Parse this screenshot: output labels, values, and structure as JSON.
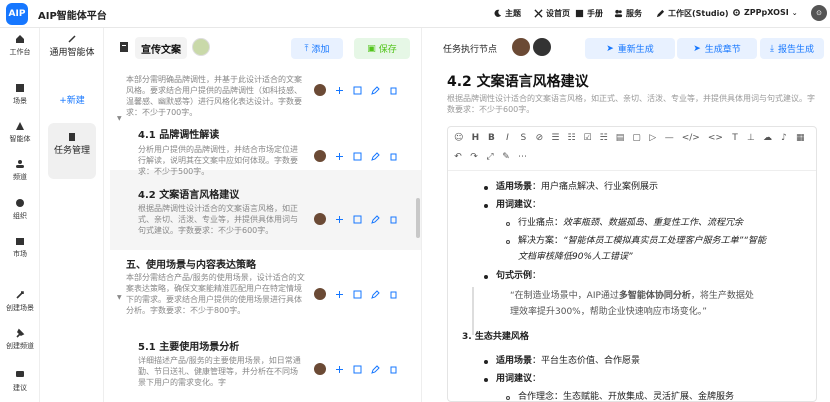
{
  "app": {
    "logo": "AIP",
    "title": "AIP智能体平台"
  },
  "topnav": [
    {
      "label": "主题",
      "icon": "moon-icon"
    },
    {
      "label": "设首页",
      "icon": "tools-icon"
    },
    {
      "label": "手册",
      "icon": "book-icon"
    },
    {
      "label": "服务",
      "icon": "users-icon"
    },
    {
      "label": "工作区(Studio)",
      "icon": "pen-icon"
    },
    {
      "label": "ZPPpXOSI",
      "icon": "gear-icon"
    }
  ],
  "leftnav": [
    {
      "label": "工作台"
    },
    {
      "label": "场景"
    },
    {
      "label": "智能体"
    },
    {
      "label": "频道"
    },
    {
      "label": "组织"
    },
    {
      "label": "市场"
    },
    {
      "label": "创建场景"
    },
    {
      "label": "创建频道"
    },
    {
      "label": "建议"
    }
  ],
  "panel2": {
    "title": "通用智能体",
    "new_label": "+新建",
    "task_label": "任务管理"
  },
  "doc": {
    "title": "宣传文案",
    "add_label": "添加",
    "save_label": "保存"
  },
  "outline": {
    "intro": "本部分需明确品牌调性，并基于此设计适合的文案风格。要求结合用户提供的品牌调性（如科技感、温馨感、幽默感等）进行风格化表达设计。字数要求：不少于700字。",
    "h41": "4.1 品牌调性解读",
    "t41": "分析用户提供的品牌调性，并结合市场定位进行解读，说明其在文案中应如何体现。字数要求：不少于500字。",
    "h42": "4.2 文案语言风格建议",
    "t42": "根据品牌调性设计适合的文案语言风格，如正式、亲切、活泼、专业等，并提供具体用词与句式建议。字数要求：不少于600字。",
    "h5": "五、使用场景与内容表达策略",
    "t5": "本部分需结合产品/服务的使用场景，设计适合的文案表达策略，确保文案能精准匹配用户在特定情境下的需求。要求结合用户提供的使用场景进行具体分析。字数要求：不少于800字。",
    "h51": "5.1 主要使用场景分析",
    "t51": "详细描述产品/服务的主要使用场景，如日常通勤、节日送礼、健康管理等，并分析在不同场景下用户的需求变化。字"
  },
  "right": {
    "label": "任务执行节点",
    "regen": "重新生成",
    "gen_chapter": "生成章节",
    "gen_report": "报告生成",
    "title": "4.2 文案语言风格建议",
    "desc": "根据品牌调性设计适合的文案语言风格，如正式、亲切、活泼、专业等，并提供具体用词与句式建议。字数要求：不少于600字。",
    "toolbar_row1": [
      "☺",
      "H",
      "B",
      "I",
      "S",
      "⊘",
      "☰",
      "☷",
      "☑",
      "☵",
      "▤",
      "▢",
      "▷",
      "—",
      "</>",
      "<>",
      "T",
      "⊥",
      "☁",
      "♪",
      "▦"
    ],
    "toolbar_row2": [
      "↶",
      "↷",
      "⤢",
      "✎",
      "⋯"
    ],
    "c1_label": "适用场景",
    "c1_text": "：用户痛点解决、行业案例展示",
    "c2_label": "用词建议",
    "c2_text": "：",
    "c3_pre": "行业痛点：",
    "c3_text": "效率瓶颈、数据孤岛、重复性工作、流程冗余",
    "c4_pre": "解决方案：",
    "c4_text": "“智能体员工模拟真实员工处理客户服务工单”“智能",
    "c4_text2": "文档审核降低90%人工错误”",
    "c5_label": "句式示例",
    "c5_text": "：",
    "q1a": "“在制造业场景中，AIP通过",
    "q1b": "多智能体协同分析",
    "q1c": "，将生产数据处",
    "q2": "理效率提升300%，帮助企业快速响应市场变化。”",
    "h3": "3. 生态共建风格",
    "c6_label": "适用场景",
    "c6_text": "：平台生态价值、合作愿景",
    "c7_label": "用词建议",
    "c7_text": "：",
    "c8": "合作理念：生态赋能、开放集成、灵活扩展、金牌服务"
  }
}
